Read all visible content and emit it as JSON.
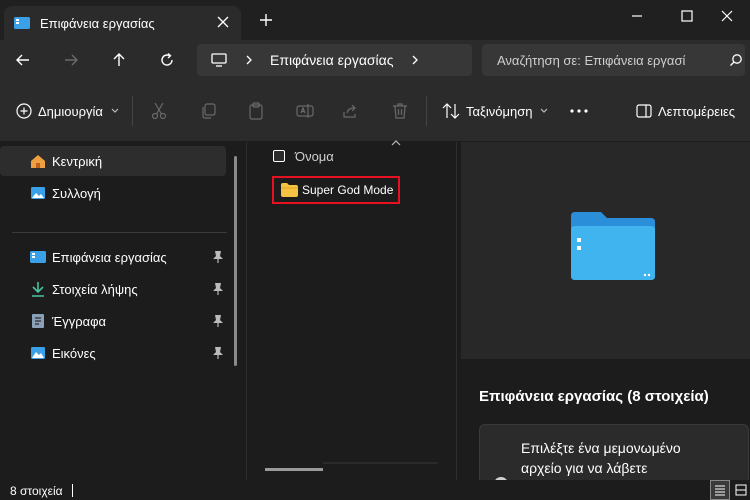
{
  "window": {
    "tab_title": "Επιφάνεια εργασίας"
  },
  "address": {
    "location": "Επιφάνεια εργασίας"
  },
  "search": {
    "placeholder": "Αναζήτηση σε: Επιφάνεια εργασί"
  },
  "commands": {
    "new_label": "Δημιουργία",
    "sort_label": "Ταξινόμηση",
    "details_label": "Λεπτομέρειες"
  },
  "sidebar": {
    "items": [
      {
        "label": "Κεντρική",
        "icon": "home-icon",
        "selected": true
      },
      {
        "label": "Συλλογή",
        "icon": "gallery-icon"
      },
      {
        "label": "Επιφάνεια εργασίας",
        "icon": "desktop-icon",
        "pinned": true
      },
      {
        "label": "Στοιχεία λήψης",
        "icon": "download-icon",
        "pinned": true
      },
      {
        "label": "Έγγραφα",
        "icon": "documents-icon",
        "pinned": true
      },
      {
        "label": "Εικόνες",
        "icon": "pictures-icon",
        "pinned": true
      }
    ]
  },
  "filelist": {
    "column_name": "Όνομα",
    "files": [
      {
        "name": "Super God Mode",
        "type": "folder"
      }
    ]
  },
  "details_pane": {
    "title": "Επιφάνεια εργασίας (8 στοιχεία)",
    "hint": "Επιλέξτε ένα μεμονωμένο αρχείο για να λάβετε"
  },
  "status": {
    "item_count": "8 στοιχεία"
  },
  "colors": {
    "background": "#1c1c1c",
    "toolbar": "#2b2b2b",
    "highlight_box": "#e81123",
    "folder": "#f5c242",
    "accent_blue": "#3aa0e8"
  }
}
